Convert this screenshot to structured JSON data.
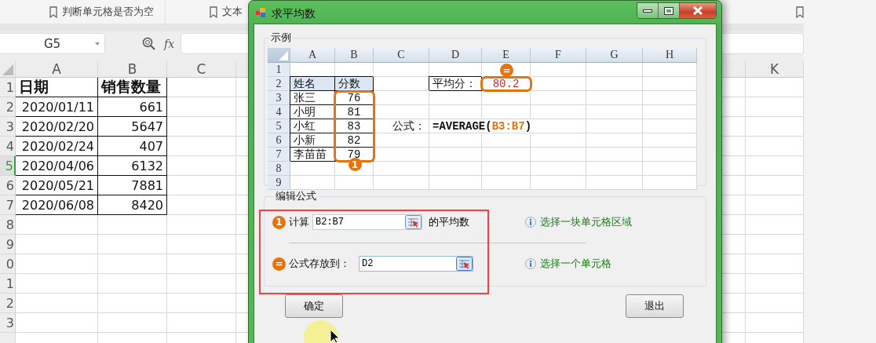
{
  "toolbar_tabs": [
    {
      "label": "判断单元格是否为空"
    },
    {
      "label": "文本"
    }
  ],
  "formula_bar": {
    "name_box": "G5",
    "fx_label": "fx"
  },
  "sheet": {
    "columns": [
      "A",
      "B",
      "C",
      "K"
    ],
    "rows": [
      {
        "number": "1",
        "selected": false,
        "kind": "header",
        "cells": [
          "日期",
          "销售数量"
        ]
      },
      {
        "number": "2",
        "selected": false,
        "kind": "data",
        "cells": [
          "2020/01/11",
          "661"
        ]
      },
      {
        "number": "3",
        "selected": false,
        "kind": "data",
        "cells": [
          "2020/02/20",
          "5647"
        ]
      },
      {
        "number": "4",
        "selected": false,
        "kind": "data",
        "cells": [
          "2020/02/24",
          "407"
        ]
      },
      {
        "number": "5",
        "selected": true,
        "kind": "data",
        "cells": [
          "2020/04/06",
          "6132"
        ]
      },
      {
        "number": "6",
        "selected": false,
        "kind": "data",
        "cells": [
          "2020/05/21",
          "7881"
        ]
      },
      {
        "number": "7",
        "selected": false,
        "kind": "data",
        "cells": [
          "2020/06/08",
          "8420"
        ]
      },
      {
        "number": "8",
        "selected": false,
        "kind": "empty",
        "cells": []
      },
      {
        "number": "9",
        "selected": false,
        "kind": "empty",
        "cells": []
      },
      {
        "number": "0",
        "selected": false,
        "kind": "empty",
        "cells": []
      },
      {
        "number": "1",
        "selected": false,
        "kind": "empty",
        "cells": []
      },
      {
        "number": "2",
        "selected": false,
        "kind": "empty",
        "cells": []
      },
      {
        "number": "3",
        "selected": false,
        "kind": "empty",
        "cells": []
      }
    ]
  },
  "dialog": {
    "title": "求平均数",
    "example": {
      "label": "示例",
      "columns": [
        "A",
        "B",
        "C",
        "D",
        "E",
        "F",
        "G",
        "H"
      ],
      "row_numbers": [
        "1",
        "2",
        "3",
        "4",
        "5",
        "6",
        "7",
        "8",
        "9"
      ],
      "table": [
        {
          "kind": "header",
          "name": "姓名",
          "score": "分数"
        },
        {
          "kind": "data",
          "name": "张三",
          "score": "76"
        },
        {
          "kind": "data",
          "name": "小明",
          "score": "81"
        },
        {
          "kind": "data",
          "name": "小红",
          "score": "83"
        },
        {
          "kind": "data",
          "name": "小新",
          "score": "82"
        },
        {
          "kind": "data",
          "name": "李苗苗",
          "score": "79"
        }
      ],
      "average_label": "平均分：",
      "average_value": "80.2",
      "formula_label": "公式：",
      "formula": {
        "prefix": "=AVERAGE(",
        "range": "B3:B7",
        "suffix": ")"
      },
      "range_marker": "1",
      "result_marker": "="
    },
    "edit": {
      "label": "编辑公式",
      "range_row": {
        "marker": "1",
        "label": "计算",
        "value": "B2:B7",
        "suffix": "的平均数",
        "hint": "选择一块单元格区域"
      },
      "target_row": {
        "marker": "=",
        "label": "公式存放到：",
        "value": "D2",
        "hint": "选择一个单元格"
      }
    },
    "ok_button": "确定",
    "exit_button": "退出"
  }
}
